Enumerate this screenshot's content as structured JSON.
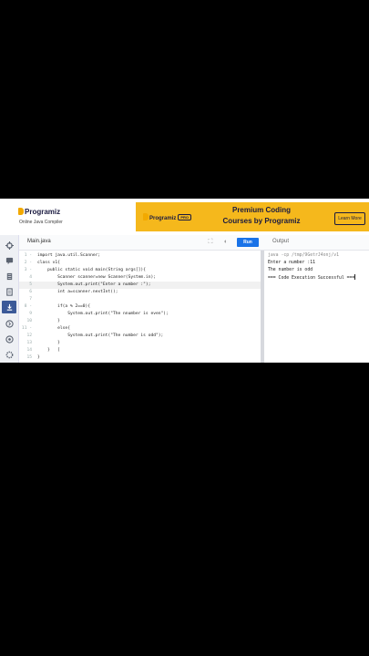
{
  "header": {
    "logo_text": "Programiz",
    "subtitle": "Online Java Compiler"
  },
  "banner": {
    "logo_text": "Programiz",
    "pro_badge": "PRO",
    "title_line1": "Premium Coding",
    "title_line2": "Courses by Programiz",
    "cta_label": "Learn More",
    "background_color": "#f5b81c"
  },
  "sidebar": {
    "items": [
      {
        "icon": "java-icon"
      },
      {
        "icon": "chat-icon"
      },
      {
        "icon": "list-icon"
      },
      {
        "icon": "book-icon"
      },
      {
        "icon": "document-icon"
      },
      {
        "icon": "code-icon",
        "active": true
      },
      {
        "icon": "share-icon"
      },
      {
        "icon": "settings-icon"
      },
      {
        "icon": "gear-icon"
      }
    ]
  },
  "toolbar": {
    "file_tab": "Main.java",
    "run_label": "Run",
    "output_tab": "Output",
    "run_color": "#1a73e8"
  },
  "editor": {
    "lines": [
      {
        "num": "1 -",
        "code": "import java.util.Scanner;"
      },
      {
        "num": "2 -",
        "code": "class v1{"
      },
      {
        "num": "3 -",
        "code": "    public static void main(String args[]){"
      },
      {
        "num": "4",
        "code": "        Scanner scanner=new Scanner(System.in);"
      },
      {
        "num": "5",
        "code": "        System.out.print(\"Enter a number :\");"
      },
      {
        "num": "6",
        "code": "        int a=scanner.nextInt();"
      },
      {
        "num": "7",
        "code": ""
      },
      {
        "num": "8 -",
        "code": "        if(a % 2==0){"
      },
      {
        "num": "9",
        "code": "            System.out.print(\"The nnumber is even\");"
      },
      {
        "num": "10",
        "code": "        }"
      },
      {
        "num": "11 -",
        "code": "        else{"
      },
      {
        "num": "12",
        "code": "            System.out.print(\"The number is odd\");"
      },
      {
        "num": "13",
        "code": "        }"
      },
      {
        "num": "14",
        "code": "    }   ["
      },
      {
        "num": "15",
        "code": "}"
      }
    ]
  },
  "output": {
    "lines": [
      "java -cp /tmp/9GetrJ4onj/v1",
      "Enter a number :11",
      "The number is odd",
      "=== Code Execution Successful ==="
    ]
  }
}
